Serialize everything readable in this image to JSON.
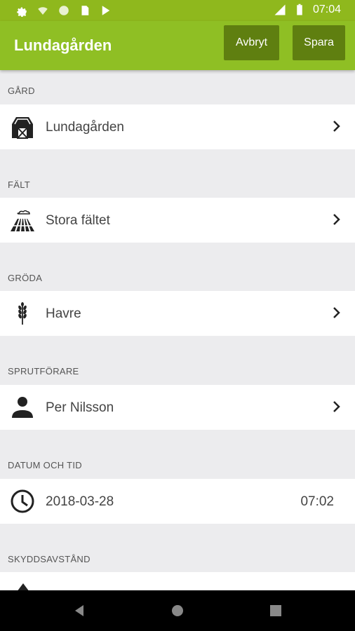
{
  "status_bar": {
    "time": "07:04",
    "network": "LTE"
  },
  "app_bar": {
    "title": "Lundagården",
    "cancel_label": "Avbryt",
    "save_label": "Spara"
  },
  "sections": [
    {
      "label": "GÅRD",
      "value": "Lundagården",
      "icon": "barn-icon"
    },
    {
      "label": "FÄLT",
      "value": "Stora fältet",
      "icon": "field-icon"
    },
    {
      "label": "GRÖDA",
      "value": "Havre",
      "icon": "wheat-icon"
    },
    {
      "label": "SPRUTFÖRARE",
      "value": "Per Nilsson",
      "icon": "person-icon"
    },
    {
      "label": "DATUM OCH TID",
      "value": "2018-03-28",
      "time": "07:02",
      "icon": "clock-icon"
    },
    {
      "label": "SKYDDSAVSTÅND"
    }
  ],
  "colors": {
    "status_bar": "#8fb81d",
    "app_bar": "#8fbf24",
    "button": "#5f7f10",
    "background": "#ececee"
  }
}
